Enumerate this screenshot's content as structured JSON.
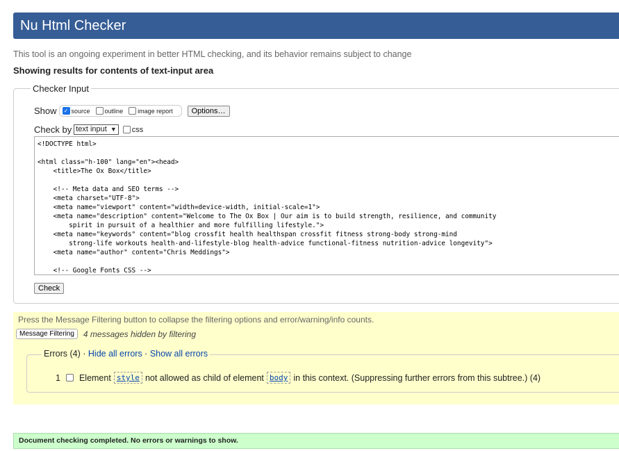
{
  "header": {
    "title": "Nu Html Checker"
  },
  "intro": "This tool is an ongoing experiment in better HTML checking, and its behavior remains subject to change",
  "showing": "Showing results for contents of text-input area",
  "checker_input": {
    "legend": "Checker Input",
    "show_label": "Show",
    "show_options": [
      {
        "label": "source",
        "checked": true
      },
      {
        "label": "outline",
        "checked": false
      },
      {
        "label": "image report",
        "checked": false
      }
    ],
    "options_button": "Options…",
    "check_by_label": "Check by",
    "check_by_value": "text input",
    "css_label": "css",
    "css_checked": false,
    "source": "<!DOCTYPE html>\n\n<html class=\"h-100\" lang=\"en\"><head>\n    <title>The Ox Box</title>\n\n    <!-- Meta data and SEO terms -->\n    <meta charset=\"UTF-8\">\n    <meta name=\"viewport\" content=\"width=device-width, initial-scale=1\">\n    <meta name=\"description\" content=\"Welcome to The Ox Box | Our aim is to build strength, resilience, and community\n        spirit in pursuit of a healthier and more fulfilling lifestyle.\">\n    <meta name=\"keywords\" content=\"blog crossfit health healthspan crossfit fitness strong-body strong-mind\n        strong-life workouts health-and-lifestyle-blog health-advice functional-fitness nutrition-advice longevity\">\n    <meta name=\"author\" content=\"Chris Meddings\">\n\n    <!-- Google Fonts CSS -->",
    "check_button": "Check"
  },
  "filtering": {
    "press_text": "Press the Message Filtering button to collapse the filtering options and error/warning/info counts.",
    "button": "Message Filtering",
    "hidden_text": "4 messages hidden by filtering"
  },
  "errors": {
    "legend": "Errors (4)",
    "separator": " · ",
    "hide_all": "Hide all errors",
    "show_all": "Show all errors",
    "items": [
      {
        "number": "1",
        "pre": "Element",
        "code1": "style",
        "mid": "not allowed as child of element",
        "code2": "body",
        "post": "in this context. (Suppressing further errors from this subtree.) (4)"
      }
    ]
  },
  "status": "Document checking completed. No errors or warnings to show.",
  "colors": {
    "header": "#365d95",
    "filter_bg": "#ffffcc",
    "success_bg": "#ccffcc",
    "link": "#0645ad"
  }
}
